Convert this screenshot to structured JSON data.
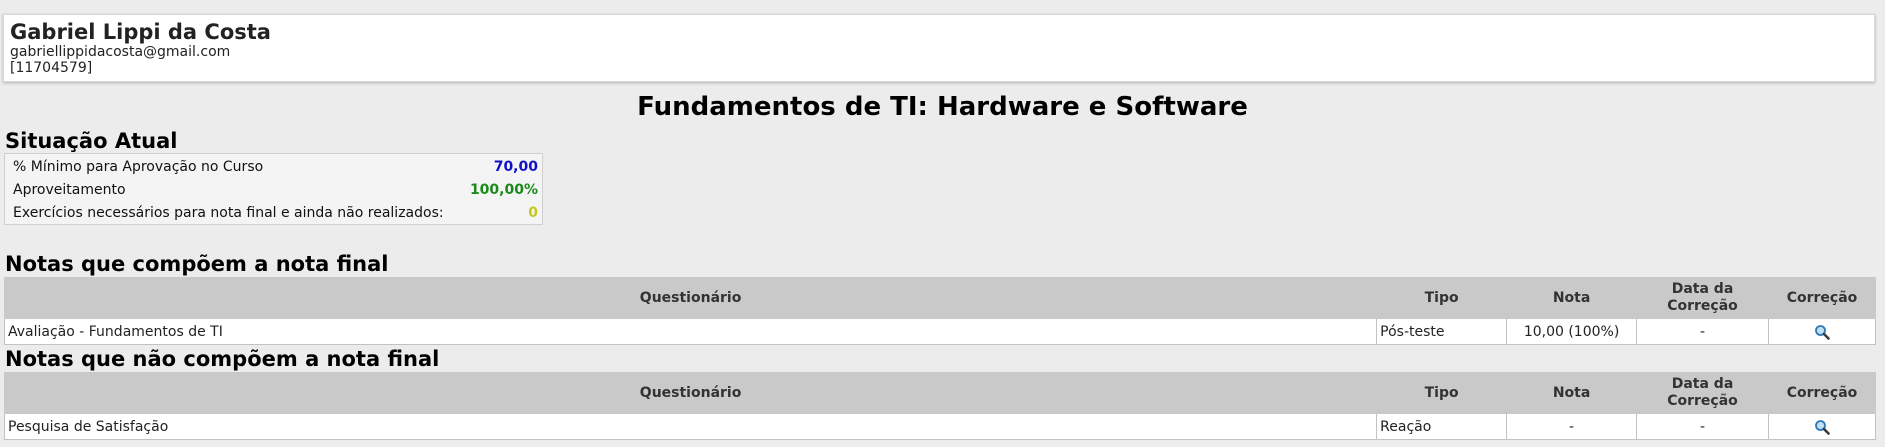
{
  "user": {
    "name": "Gabriel Lippi da Costa",
    "email": "gabriellippidacosta@gmail.com",
    "id": "[11704579]"
  },
  "course": {
    "title": "Fundamentos de TI: Hardware e Software"
  },
  "status": {
    "title": "Situação Atual",
    "rows": [
      {
        "label": "% Mínimo para Aprovação no Curso",
        "value": "70,00",
        "color": "#1010c8"
      },
      {
        "label": "Aproveitamento",
        "value": "100,00%",
        "color": "#1a8a1a"
      },
      {
        "label": "Exercícios necessários para nota final e ainda não realizados:",
        "value": "0",
        "color": "#c8c81a"
      }
    ]
  },
  "final_grades": {
    "title": "Notas que compõem a nota final",
    "headers": [
      "Questionário",
      "Tipo",
      "Nota",
      "Data da Correção",
      "Correção"
    ],
    "rows": [
      {
        "questionario": "Avaliação - Fundamentos de TI",
        "tipo": "Pós-teste",
        "nota": "10,00 (100%)",
        "data": "-",
        "correcao_icon": "search-icon"
      }
    ]
  },
  "other_grades": {
    "title": "Notas que não compõem a nota final",
    "headers": [
      "Questionário",
      "Tipo",
      "Nota",
      "Data da Correção",
      "Correção"
    ],
    "rows": [
      {
        "questionario": "Pesquisa de Satisfação",
        "tipo": "Reação",
        "nota": "-",
        "data": "-",
        "correcao_icon": "search-icon"
      }
    ]
  }
}
